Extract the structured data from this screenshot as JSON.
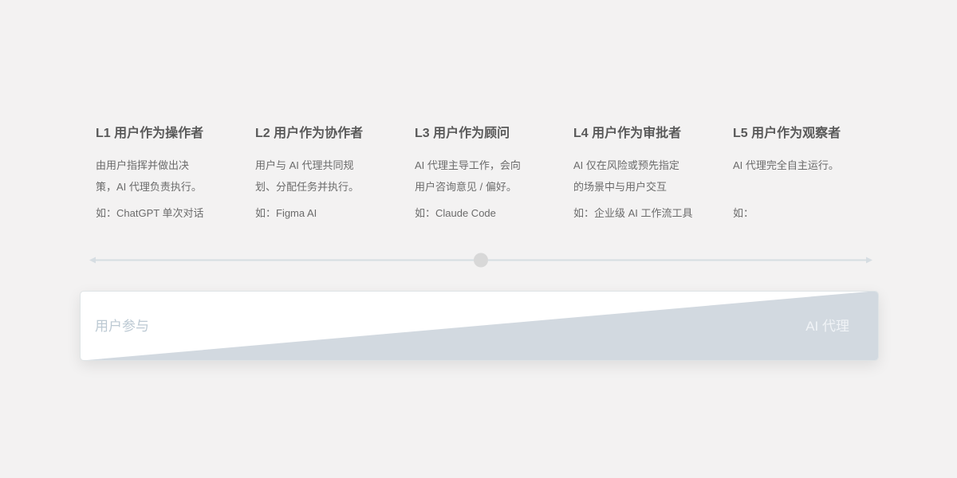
{
  "levels": [
    {
      "title": "L1 用户作为操作者",
      "desc_lines": [
        "由用户指挥并做出决",
        "策，AI 代理负责执行。"
      ],
      "example": "如：ChatGPT 单次对话"
    },
    {
      "title": "L2 用户作为协作者",
      "desc_lines": [
        "用户与 AI 代理共同规",
        "划、分配任务并执行。"
      ],
      "example": "如：Figma AI"
    },
    {
      "title": "L3 用户作为顾问",
      "desc_lines": [
        "AI 代理主导工作，会向",
        "用户咨询意见 / 偏好。"
      ],
      "example": "如：Claude Code"
    },
    {
      "title": "L4 用户作为审批者",
      "desc_lines": [
        "AI 仅在风险或预先指定",
        "的场景中与用户交互"
      ],
      "example": "如：企业级 AI 工作流工具"
    },
    {
      "title": "L5 用户作为观察者",
      "desc_lines": [
        "AI 代理完全自主运行。",
        ""
      ],
      "example": "如："
    }
  ],
  "slider": {
    "value_fraction": 0.5
  },
  "bar": {
    "left_label": "用户参与",
    "right_label": "AI 代理"
  },
  "colors": {
    "background": "#f3f2f2",
    "title_text": "#595959",
    "body_text": "#6b6b6b",
    "axis_line": "#d6dde2",
    "slider_knob": "#d8d8d8",
    "bar_fill": "#d2d9e0",
    "bar_background": "#ffffff"
  }
}
